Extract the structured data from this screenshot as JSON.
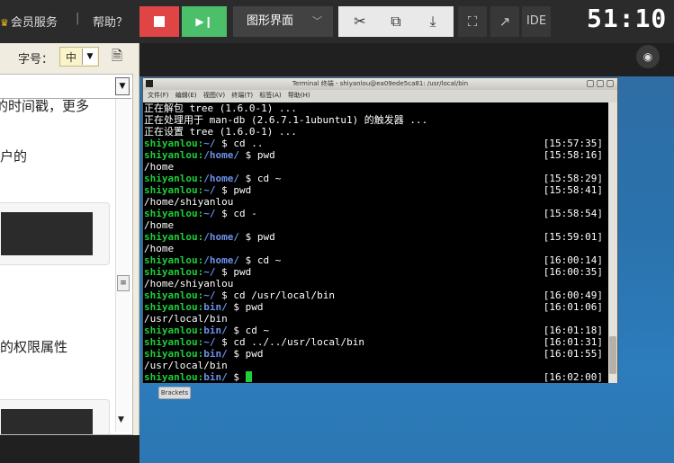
{
  "header": {
    "vip_label": "会员服务",
    "separator": "|",
    "help_label": "帮助？",
    "mode_label": "图形界面",
    "ide_label": "IDE",
    "timer": "51:10"
  },
  "icons": {
    "crown": "crown-icon",
    "stop": "stop-icon",
    "next": "skip-next-icon",
    "scissors": "scissors-icon",
    "screen": "screen-share-icon",
    "download": "download-icon",
    "fullscreen": "fullscreen-icon",
    "external": "open-external-icon",
    "eye": "eye-icon"
  },
  "colors": {
    "stop_red": "#e04545",
    "next_green": "#4cbf6b",
    "prompt_green": "#1fd03a",
    "path_blue": "#6c90e8",
    "desktop_blue": "#2d7cbc"
  },
  "left_panel": {
    "font_size_label": "字号：",
    "font_size_value": "中",
    "text_1": "的时间戳，更多",
    "text_2": "户的",
    "text_3": "的权限属性"
  },
  "terminal": {
    "title": "Terminal 终端 - shiyanlou@ea09ede5ca81: /usr/local/bin",
    "menus": [
      "文件(F)",
      "编辑(E)",
      "视图(V)",
      "终端(T)",
      "标签(A)",
      "帮助(H)"
    ],
    "lines": [
      {
        "text": "正在解包 tree (1.6.0-1) ..."
      },
      {
        "text": "正在处理用于 man-db (2.6.7.1-1ubuntu1) 的触发器 ..."
      },
      {
        "text": "正在设置 tree (1.6.0-1) ..."
      },
      {
        "user": "shiyanlou:",
        "path": "~/",
        "cmd": " $ cd ..",
        "ts": "[15:57:35]"
      },
      {
        "user": "shiyanlou:",
        "path": "/home/",
        "cmd": " $ pwd",
        "ts": "[15:58:16]"
      },
      {
        "text": "/home"
      },
      {
        "user": "shiyanlou:",
        "path": "/home/",
        "cmd": " $ cd ~",
        "ts": "[15:58:29]"
      },
      {
        "user": "shiyanlou:",
        "path": "~/",
        "cmd": " $ pwd",
        "ts": "[15:58:41]"
      },
      {
        "text": "/home/shiyanlou"
      },
      {
        "user": "shiyanlou:",
        "path": "~/",
        "cmd": " $ cd -",
        "ts": "[15:58:54]"
      },
      {
        "text": "/home"
      },
      {
        "user": "shiyanlou:",
        "path": "/home/",
        "cmd": " $ pwd",
        "ts": "[15:59:01]"
      },
      {
        "text": "/home"
      },
      {
        "user": "shiyanlou:",
        "path": "/home/",
        "cmd": " $ cd ~",
        "ts": "[16:00:14]"
      },
      {
        "user": "shiyanlou:",
        "path": "~/",
        "cmd": " $ pwd",
        "ts": "[16:00:35]"
      },
      {
        "text": "/home/shiyanlou"
      },
      {
        "user": "shiyanlou:",
        "path": "~/",
        "cmd": " $ cd /usr/local/bin",
        "ts": "[16:00:49]"
      },
      {
        "user": "shiyanlou:",
        "path": "bin/",
        "cmd": " $ pwd",
        "ts": "[16:01:06]"
      },
      {
        "text": "/usr/local/bin"
      },
      {
        "user": "shiyanlou:",
        "path": "bin/",
        "cmd": " $ cd ~",
        "ts": "[16:01:18]"
      },
      {
        "user": "shiyanlou:",
        "path": "~/",
        "cmd": " $ cd ../../usr/local/bin",
        "ts": "[16:01:31]"
      },
      {
        "user": "shiyanlou:",
        "path": "bin/",
        "cmd": " $ pwd",
        "ts": "[16:01:55]"
      },
      {
        "text": "/usr/local/bin"
      },
      {
        "user": "shiyanlou:",
        "path": "bin/",
        "cmd": " $ ",
        "ts": "[16:02:00]",
        "cursor": true
      }
    ]
  },
  "taskbar": {
    "brackets_label": "Brackets"
  }
}
